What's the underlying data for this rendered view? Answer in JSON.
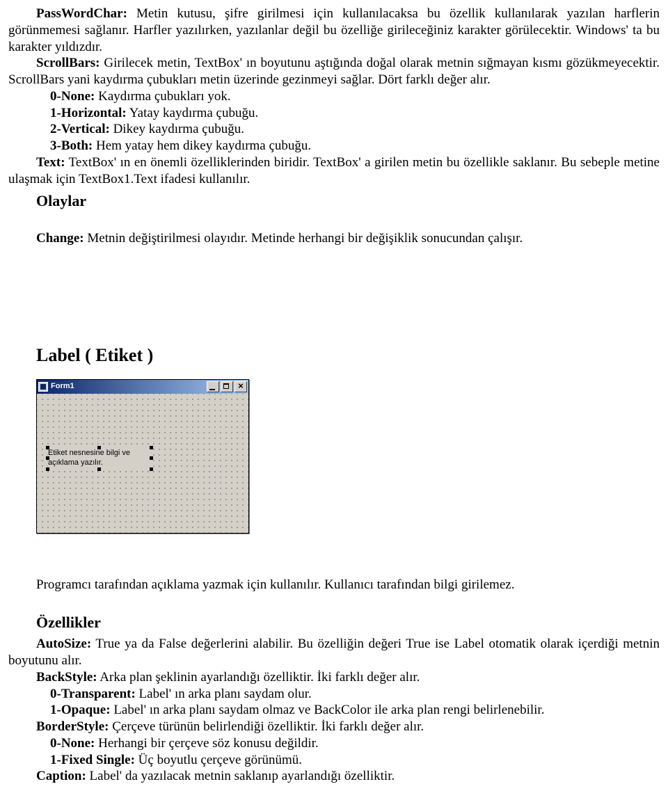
{
  "p_passwordchar": {
    "label": "PassWordChar:",
    "text": " Metin kutusu, şifre girilmesi için kullanılacaksa bu özellik kullanılarak yazılan harflerin görünmemesi sağlanır. Harfler yazılırken, yazılanlar değil bu özelliğe girileceğiniz karakter görülecektir. Windows' ta bu karakter yıldızdır."
  },
  "p_scrollbars": {
    "label": "ScrollBars:",
    "text": " Girilecek metin, TextBox' ın boyutunu aştığında doğal olarak metnin sığmayan kısmı gözükmeyecektir. ScrollBars yani kaydırma çubukları metin üzerinde gezinmeyi sağlar. Dört farklı değer alır."
  },
  "opt0": {
    "label": "0-None:",
    "text": " Kaydırma çubukları yok."
  },
  "opt1": {
    "label": "1-Horizontal:",
    "text": " Yatay kaydırma çubuğu."
  },
  "opt2": {
    "label": "2-Vertical:",
    "text": " Dikey kaydırma çubuğu."
  },
  "opt3": {
    "label": "3-Both:",
    "text": " Hem yatay hem dikey kaydırma çubuğu."
  },
  "p_text": {
    "label": "Text:",
    "text": " TextBox' ın en önemli özelliklerinden biridir. TextBox' a girilen metin bu özellikle saklanır. Bu sebeple metine ulaşmak için TextBox1.Text ifadesi kullanılır."
  },
  "h_olaylar": "Olaylar",
  "p_change": {
    "label": "Change:",
    "text": " Metnin değiştirilmesi olayıdır. Metinde herhangi bir değişiklik sonucundan çalışır."
  },
  "h_label": "Label ( Etiket )",
  "form": {
    "title": "Form1",
    "label_text": "Etiket nesnesine bilgi ve açıklama yazılır."
  },
  "p_labelintro": "Programcı tarafından açıklama yazmak için kullanılır. Kullanıcı tarafından bilgi girilemez.",
  "h_ozellikler": "Özellikler",
  "p_autosize": {
    "label": "AutoSize:",
    "text": " True ya da False değerlerini alabilir. Bu özelliğin değeri True ise Label otomatik olarak içerdiği metnin boyutunu alır."
  },
  "p_backstyle": {
    "label": "BackStyle:",
    "text": " Arka plan şeklinin ayarlandığı özelliktir. İki farklı değer alır."
  },
  "bs0": {
    "label": "0-Transparent:",
    "text": " Label' ın arka planı saydam olur."
  },
  "bs1": {
    "label": "1-Opaque:",
    "text": " Label' ın arka planı saydam olmaz ve BackColor ile arka plan rengi belirlenebilir."
  },
  "p_borderstyle": {
    "label": "BorderStyle:",
    "text": " Çerçeve türünün belirlendiği özelliktir. İki farklı değer alır."
  },
  "bd0": {
    "label": "0-None:",
    "text": " Herhangi bir çerçeve söz konusu değildir."
  },
  "bd1": {
    "label": "1-Fixed Single:",
    "text": " Üç boyutlu çerçeve görünümü."
  },
  "p_caption": {
    "label": "Caption:",
    "text": " Label' da yazılacak metnin saklanıp ayarlandığı özelliktir."
  }
}
